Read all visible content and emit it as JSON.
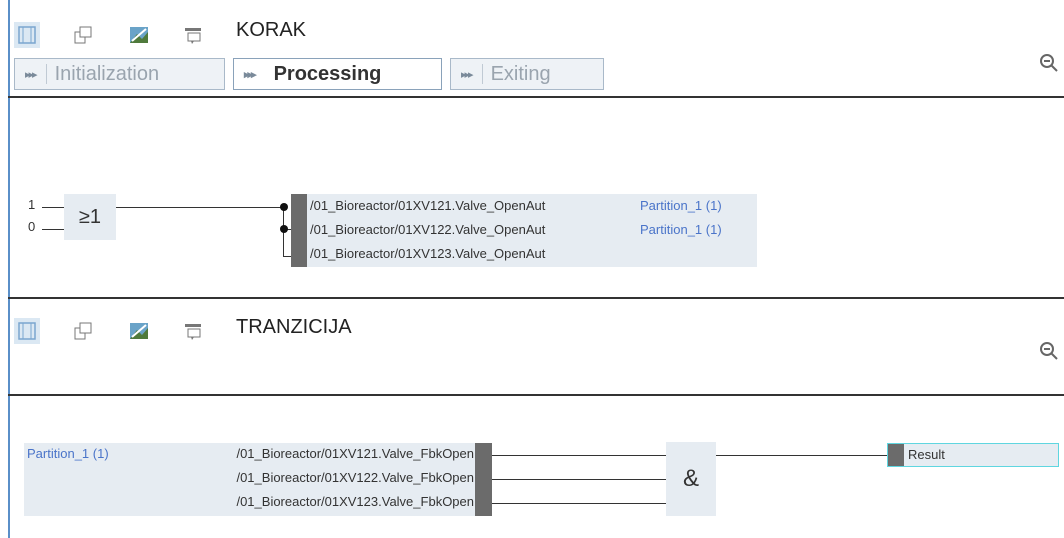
{
  "step": {
    "title": "KORAK",
    "tabs": [
      {
        "label": "Initialization"
      },
      {
        "label": "Processing"
      },
      {
        "label": "Exiting"
      }
    ],
    "gate_symbol": "≥1",
    "inputs": [
      "1",
      "0"
    ],
    "signals": [
      {
        "name": "/01_Bioreactor/01XV121.Valve_OpenAut",
        "partition": "Partition_1 (1)"
      },
      {
        "name": "/01_Bioreactor/01XV122.Valve_OpenAut",
        "partition": "Partition_1 (1)"
      },
      {
        "name": "/01_Bioreactor/01XV123.Valve_OpenAut",
        "partition": ""
      }
    ]
  },
  "transition": {
    "title": "TRANZICIJA",
    "gate_symbol": "&",
    "partition": "Partition_1 (1)",
    "signals": [
      {
        "name": "/01_Bioreactor/01XV121.Valve_FbkOpen"
      },
      {
        "name": "/01_Bioreactor/01XV122.Valve_FbkOpen"
      },
      {
        "name": "/01_Bioreactor/01XV123.Valve_FbkOpen"
      }
    ],
    "output": "Result"
  },
  "icons": [
    "view-frame-icon",
    "copy-icon",
    "image-icon",
    "comment-icon",
    "zoom-out-icon"
  ],
  "colors": {
    "accent": "#4a74c9",
    "box": "#e6ecf2",
    "bar": "#6b6b6b",
    "result_border": "#5fd6e0"
  }
}
